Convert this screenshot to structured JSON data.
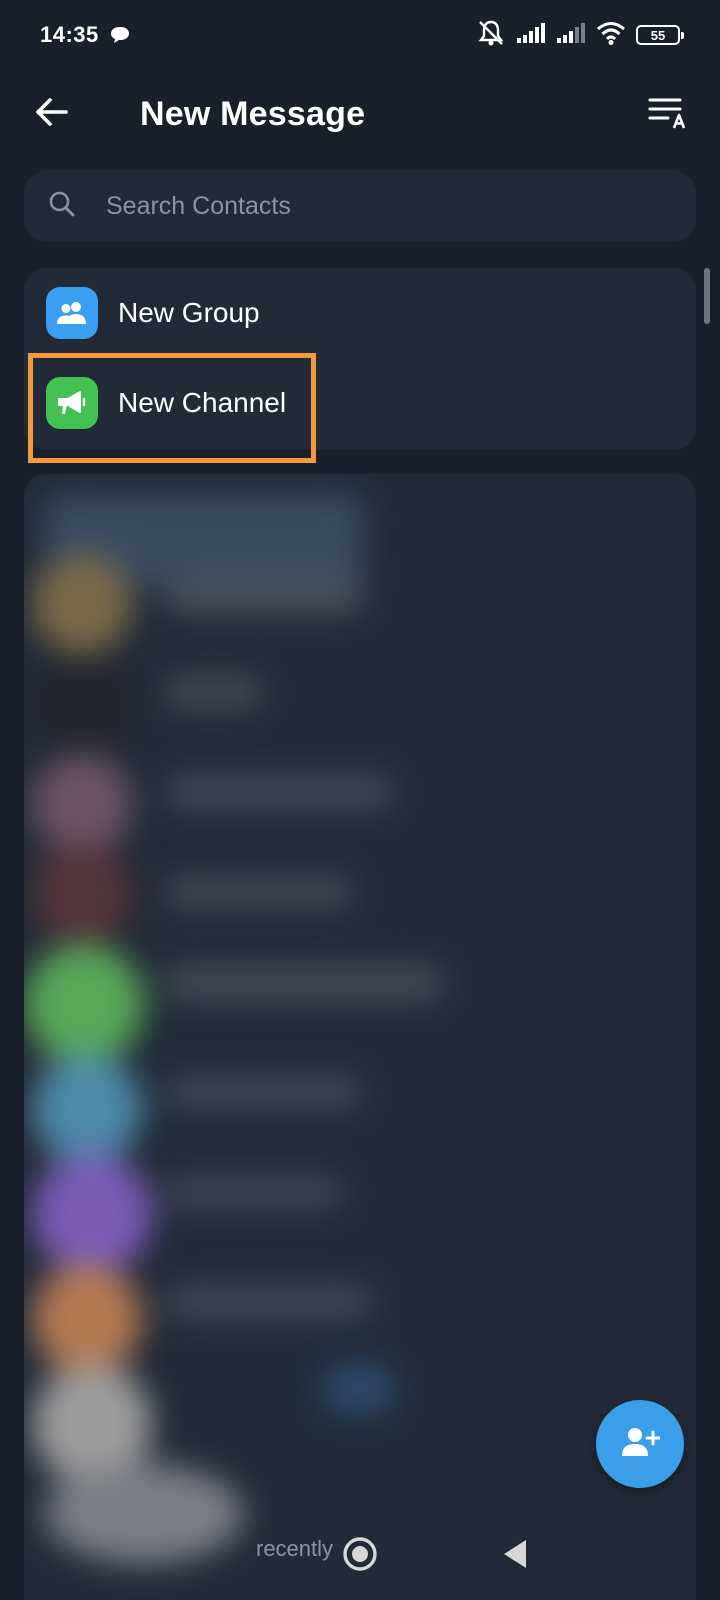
{
  "status_bar": {
    "time": "14:35",
    "battery": "55",
    "icons": [
      "chat-bubble-icon",
      "bell-muted-icon",
      "signal-icon",
      "signal-icon",
      "wifi-icon",
      "battery-icon"
    ]
  },
  "header": {
    "title": "New Message",
    "back_icon": "arrow-left-icon",
    "sort_icon": "sort-alpha-icon"
  },
  "search": {
    "placeholder": "Search Contacts",
    "icon": "search-icon"
  },
  "actions": [
    {
      "label": "New Group",
      "icon": "group-icon",
      "color": "#3a9ff0"
    },
    {
      "label": "New Channel",
      "icon": "megaphone-icon",
      "color": "#45c154"
    }
  ],
  "highlight_color": "#f59a3b",
  "contacts_partial_text": "recently",
  "fab_icon": "add-contact-icon",
  "fab_color": "#3b9eea",
  "nav": {
    "home_icon": "circle-home-icon",
    "back_icon": "triangle-back-icon"
  }
}
